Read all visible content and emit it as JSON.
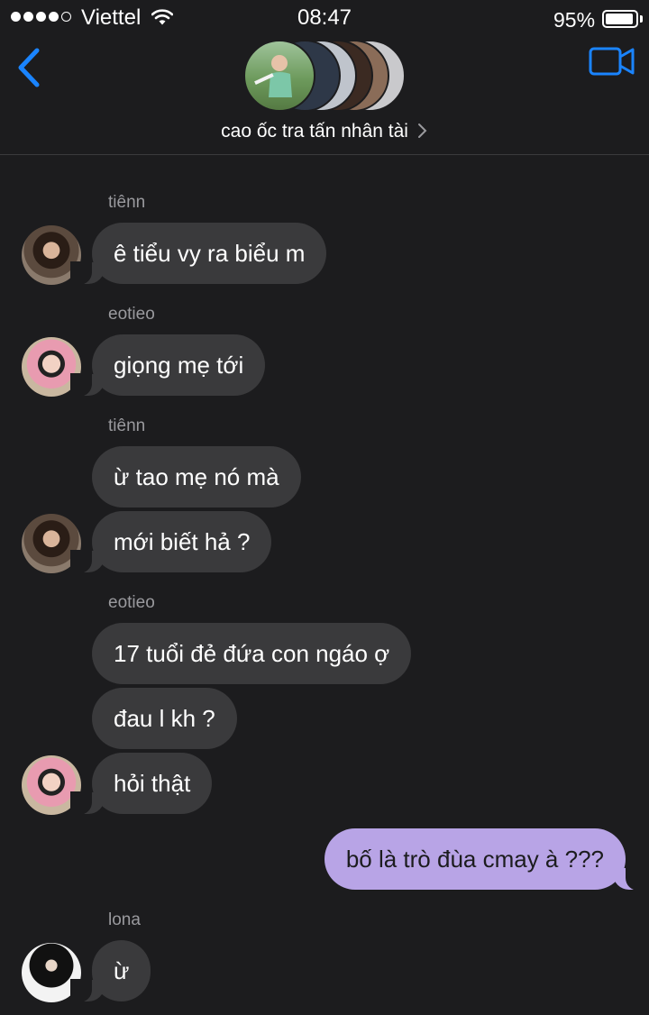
{
  "status_bar": {
    "carrier": "Viettel",
    "time": "08:47",
    "battery_percent": "95%",
    "battery_level": 0.95,
    "signal_bars_filled": 4,
    "signal_bars_total": 5
  },
  "header": {
    "back_icon": "chevron-left-icon",
    "video_icon": "video-camera-icon",
    "group_name": "cao ốc tra tấn nhân tài",
    "title_chevron": "chevron-right-icon",
    "accent_color": "#1a84ff"
  },
  "colors": {
    "background": "#1c1c1e",
    "incoming_bubble": "#3a3a3c",
    "outgoing_bubble": "#b8a4e6",
    "sender_name": "#9a9a9e"
  },
  "messages": [
    {
      "sender": "tiênn",
      "text": "ê tiểu vy ra biểu m"
    },
    {
      "sender": "eotieo",
      "text": "giọng mẹ tới"
    },
    {
      "sender": "tiênn",
      "text": "ừ tao mẹ nó mà"
    },
    {
      "sender": "tiênn",
      "text": "mới biết hả ?"
    },
    {
      "sender": "eotieo",
      "text": "17 tuổi đẻ đứa con ngáo ợ"
    },
    {
      "sender": "eotieo",
      "text": "đau l kh ?"
    },
    {
      "sender": "eotieo",
      "text": "hỏi thật"
    },
    {
      "sender": "me",
      "text": "bố là trò đùa cmay à ???"
    },
    {
      "sender": "lona",
      "text": "ừ"
    }
  ]
}
